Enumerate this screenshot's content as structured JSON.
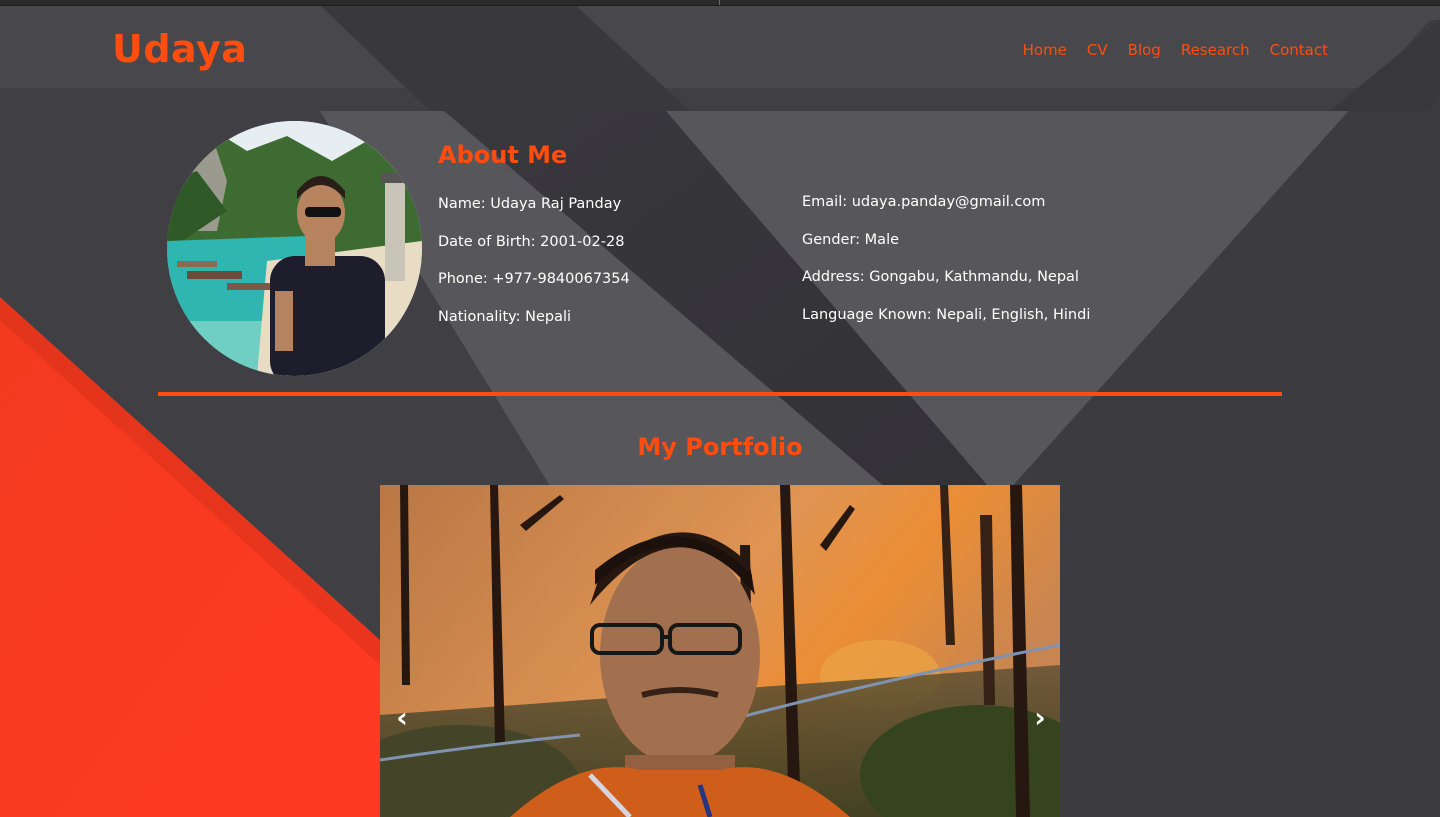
{
  "site": {
    "brand": "Udaya",
    "accent_color": "#ff4d0f"
  },
  "nav": {
    "items": [
      {
        "label": "Home"
      },
      {
        "label": "CV"
      },
      {
        "label": "Blog"
      },
      {
        "label": "Research"
      },
      {
        "label": "Contact"
      }
    ]
  },
  "about": {
    "title": "About Me",
    "left": [
      "Name: Udaya Raj Panday",
      "Date of Birth: 2001-02-28",
      "Phone: +977-9840067354",
      "Nationality: Nepali"
    ],
    "right": [
      "Email: udaya.panday@gmail.com",
      "Gender: Male",
      "Address: Gongabu, Kathmandu, Nepal",
      "Language Known: Nepali, English, Hindi"
    ]
  },
  "portfolio": {
    "title": "My Portfolio",
    "prev_icon": "‹",
    "next_icon": "›"
  }
}
